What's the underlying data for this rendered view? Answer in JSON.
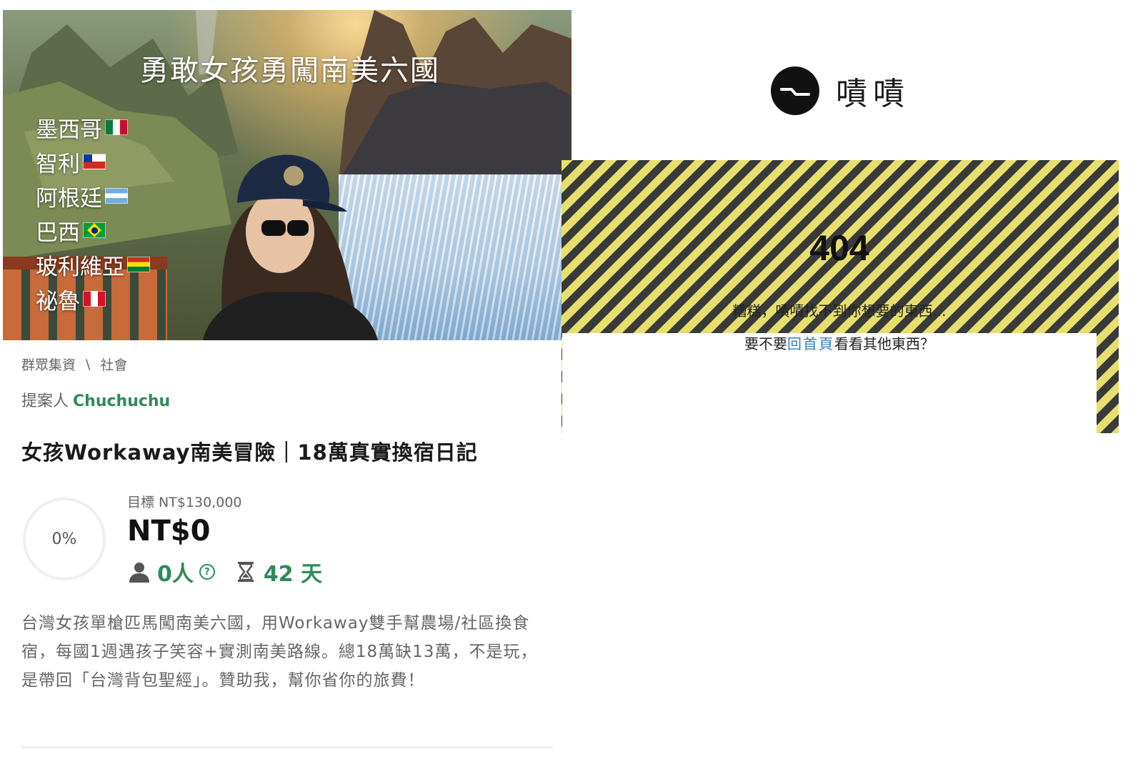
{
  "campaign": {
    "hero": {
      "title": "勇敢女孩勇闖南美六國",
      "countries": [
        {
          "name": "墨西哥",
          "flag": "mexico"
        },
        {
          "name": "智利",
          "flag": "chile"
        },
        {
          "name": "阿根廷",
          "flag": "argentina"
        },
        {
          "name": "巴西",
          "flag": "brazil"
        },
        {
          "name": "玻利維亞",
          "flag": "bolivia"
        },
        {
          "name": "祕魯",
          "flag": "peru"
        }
      ]
    },
    "breadcrumb": {
      "category": "群眾集資",
      "separator": "\\",
      "subcategory": "社會"
    },
    "proposer": {
      "label": "提案人",
      "name": "Chuchuchu"
    },
    "title": "女孩Workaway南美冒險｜18萬真實換宿日記",
    "progress": {
      "percent_label": "0%",
      "percent_value": 0,
      "goal": "目標 NT$130,000",
      "amount": "NT$0"
    },
    "stats": {
      "backers": "0人",
      "days_left": "42 天"
    },
    "description": "台灣女孩單槍匹馬闖南美六國，用Workaway雙手幫農場/社區換食宿，每國1週遇孩子笑容+實測南美路線。總18萬缺13萬，不是玩，是帶回「台灣背包聖經」。贊助我，幫你省你的旅費！"
  },
  "error_page": {
    "logo_text": "嘖嘖",
    "code": "404",
    "message": "糟糕，嘖嘖找不到你想要的東西...",
    "hint_prefix": "要不要",
    "home_link": "回首頁",
    "hint_suffix": "看看其他東西？"
  },
  "colors": {
    "accent_green": "#2e8b57",
    "link_blue": "#2f7fc0",
    "hazard_yellow": "#e6df6d",
    "hazard_dark": "#3a3a3a"
  }
}
